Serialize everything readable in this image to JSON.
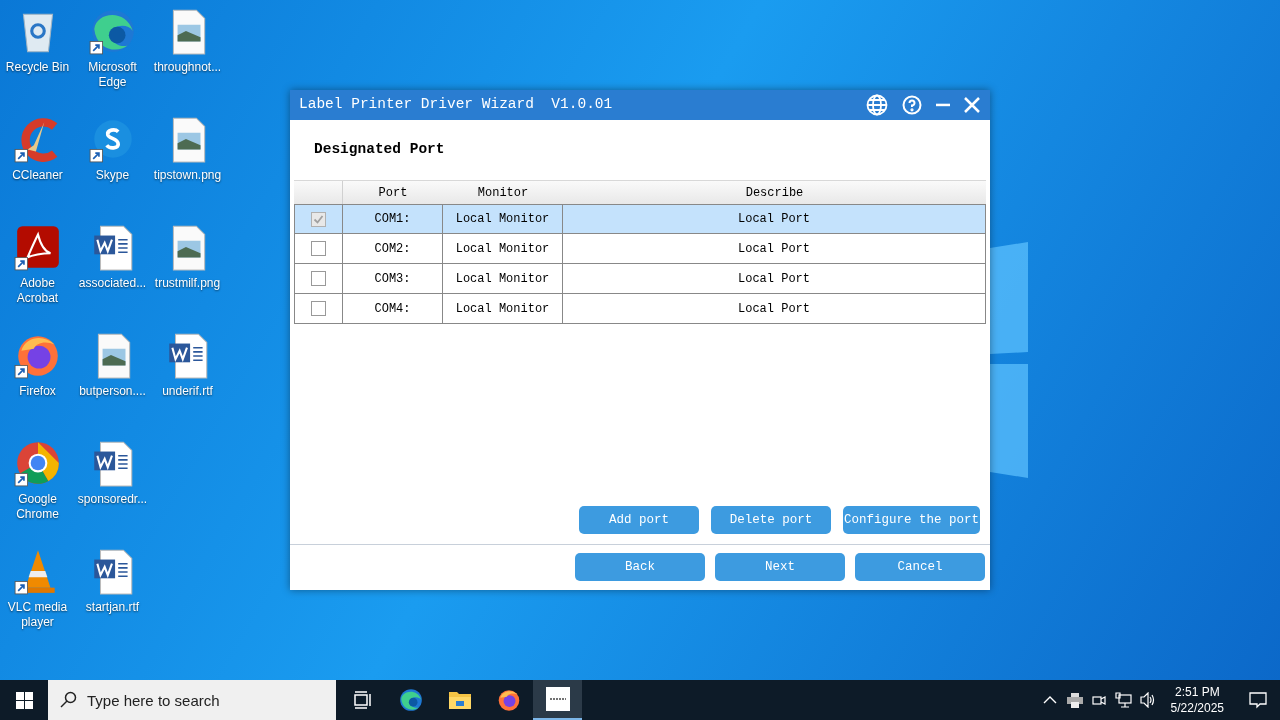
{
  "desktop_icons": [
    {
      "label": "Recycle Bin",
      "kind": "recycle",
      "shortcut": false
    },
    {
      "label": "CCleaner",
      "kind": "ccleaner",
      "shortcut": true
    },
    {
      "label": "Adobe Acrobat",
      "kind": "pdf",
      "shortcut": true
    },
    {
      "label": "Firefox",
      "kind": "firefox",
      "shortcut": true
    },
    {
      "label": "Google Chrome",
      "kind": "chrome",
      "shortcut": true
    },
    {
      "label": "VLC media player",
      "kind": "vlc",
      "shortcut": true
    },
    {
      "label": "Microsoft Edge",
      "kind": "edge",
      "shortcut": true
    },
    {
      "label": "Skype",
      "kind": "skype",
      "shortcut": true
    },
    {
      "label": "associated...",
      "kind": "word",
      "shortcut": false
    },
    {
      "label": "butperson....",
      "kind": "image",
      "shortcut": false
    },
    {
      "label": "sponsoredr...",
      "kind": "word",
      "shortcut": false
    },
    {
      "label": "startjan.rtf",
      "kind": "word",
      "shortcut": false
    },
    {
      "label": "throughnot...",
      "kind": "image",
      "shortcut": false
    },
    {
      "label": "tipstown.png",
      "kind": "image",
      "shortcut": false
    },
    {
      "label": "trustmilf.png",
      "kind": "image",
      "shortcut": false
    },
    {
      "label": "underif.rtf",
      "kind": "word",
      "shortcut": false
    }
  ],
  "dialog": {
    "title": "Label Printer Driver Wizard  V1.0.01",
    "heading": "Designated Port",
    "table": {
      "columns": [
        "Port",
        "Monitor",
        "Describe"
      ],
      "rows": [
        {
          "port": "COM1:",
          "monitor": "Local Monitor",
          "describe": "Local Port",
          "checked": true,
          "selected": true
        },
        {
          "port": "COM2:",
          "monitor": "Local Monitor",
          "describe": "Local Port",
          "checked": false,
          "selected": false
        },
        {
          "port": "COM3:",
          "monitor": "Local Monitor",
          "describe": "Local Port",
          "checked": false,
          "selected": false
        },
        {
          "port": "COM4:",
          "monitor": "Local Monitor",
          "describe": "Local Port",
          "checked": false,
          "selected": false
        }
      ]
    },
    "port_buttons": [
      "Add port",
      "Delete port",
      "Configure the port"
    ],
    "nav_buttons": [
      "Back",
      "Next",
      "Cancel"
    ]
  },
  "taskbar": {
    "search": {
      "placeholder": "Type here to search"
    },
    "apps": [
      {
        "kind": "taskview",
        "selected": false
      },
      {
        "kind": "edge",
        "selected": false
      },
      {
        "kind": "folder",
        "selected": false
      },
      {
        "kind": "firefox",
        "selected": false
      },
      {
        "kind": "app",
        "selected": true
      }
    ],
    "clock": {
      "time": "2:51 PM",
      "date": "5/22/2025"
    }
  }
}
